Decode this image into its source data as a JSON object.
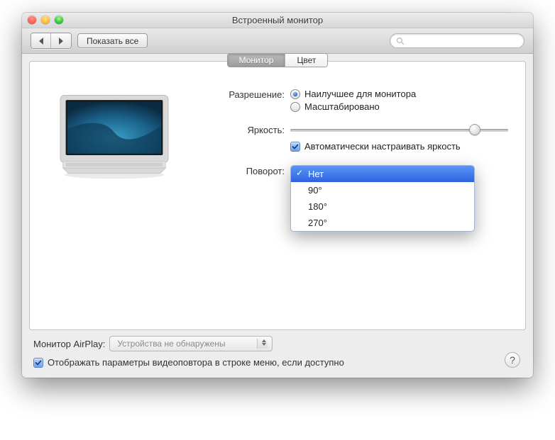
{
  "window_title": "Встроенный монитор",
  "toolbar": {
    "show_all_label": "Показать все",
    "search_placeholder": ""
  },
  "tabs": [
    {
      "label": "Монитор",
      "active": true
    },
    {
      "label": "Цвет",
      "active": false
    }
  ],
  "resolution": {
    "label": "Разрешение:",
    "options": [
      {
        "label": "Наилучшее для монитора",
        "selected": true
      },
      {
        "label": "Масштабировано",
        "selected": false
      }
    ]
  },
  "brightness": {
    "label": "Яркость:",
    "value_percent": 82,
    "auto_checkbox_label": "Автоматически настраивать яркость",
    "auto_checked": true
  },
  "rotation": {
    "label": "Поворот:",
    "options": [
      "Нет",
      "90°",
      "180°",
      "270°"
    ],
    "selected_index": 0
  },
  "airplay": {
    "label": "Монитор AirPlay:",
    "value": "Устройства не обнаружены"
  },
  "mirroring": {
    "label": "Отображать параметры видеоповтора в строке меню, если доступно",
    "checked": true
  },
  "help_label": "?"
}
